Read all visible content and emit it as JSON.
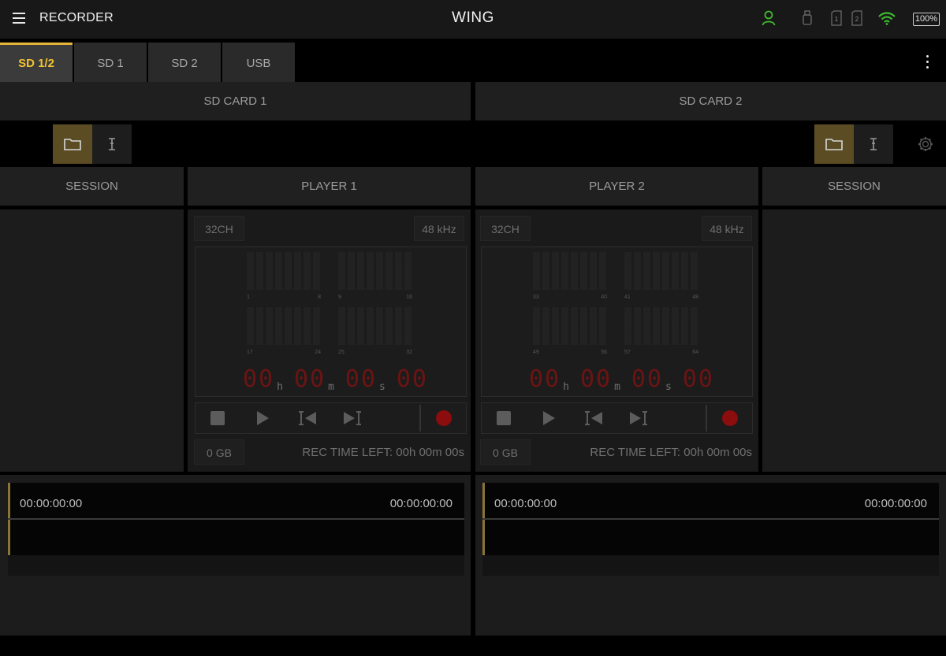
{
  "app": {
    "title": "RECORDER",
    "brand": "WING"
  },
  "status": {
    "battery": "100%",
    "sd1_label": "1",
    "sd2_label": "2"
  },
  "tabs": [
    {
      "label": "SD 1/2",
      "active": true
    },
    {
      "label": "SD 1",
      "active": false
    },
    {
      "label": "SD 2",
      "active": false
    },
    {
      "label": "USB",
      "active": false
    }
  ],
  "cards": [
    {
      "header": "SD CARD 1"
    },
    {
      "header": "SD CARD 2"
    }
  ],
  "columns": {
    "session": "SESSION",
    "player1": "PLAYER 1",
    "player2": "PLAYER 2"
  },
  "players": [
    {
      "channels": "32CH",
      "rate": "48 kHz",
      "size": "0 GB",
      "rec_left": "REC TIME LEFT: 00h 00m 00s",
      "meter_labels": [
        {
          "from": "1",
          "to": "8"
        },
        {
          "from": "9",
          "to": "16"
        },
        {
          "from": "17",
          "to": "24"
        },
        {
          "from": "25",
          "to": "32"
        }
      ],
      "tc": {
        "h": "00",
        "m": "00",
        "s": "00",
        "f": "00"
      }
    },
    {
      "channels": "32CH",
      "rate": "48 kHz",
      "size": "0 GB",
      "rec_left": "REC TIME LEFT: 00h 00m 00s",
      "meter_labels": [
        {
          "from": "33",
          "to": "40"
        },
        {
          "from": "41",
          "to": "48"
        },
        {
          "from": "49",
          "to": "56"
        },
        {
          "from": "57",
          "to": "64"
        }
      ],
      "tc": {
        "h": "00",
        "m": "00",
        "s": "00",
        "f": "00"
      }
    }
  ],
  "tc_units": {
    "h": "h",
    "m": "m",
    "s": "s"
  },
  "timelines": [
    {
      "start": "00:00:00:00",
      "end": "00:00:00:00"
    },
    {
      "start": "00:00:00:00",
      "end": "00:00:00:00"
    }
  ],
  "colors": {
    "accent": "#e3b63a",
    "wifi": "#3dbb2e",
    "user": "#3dbb2e",
    "record": "#8b0d0d"
  }
}
